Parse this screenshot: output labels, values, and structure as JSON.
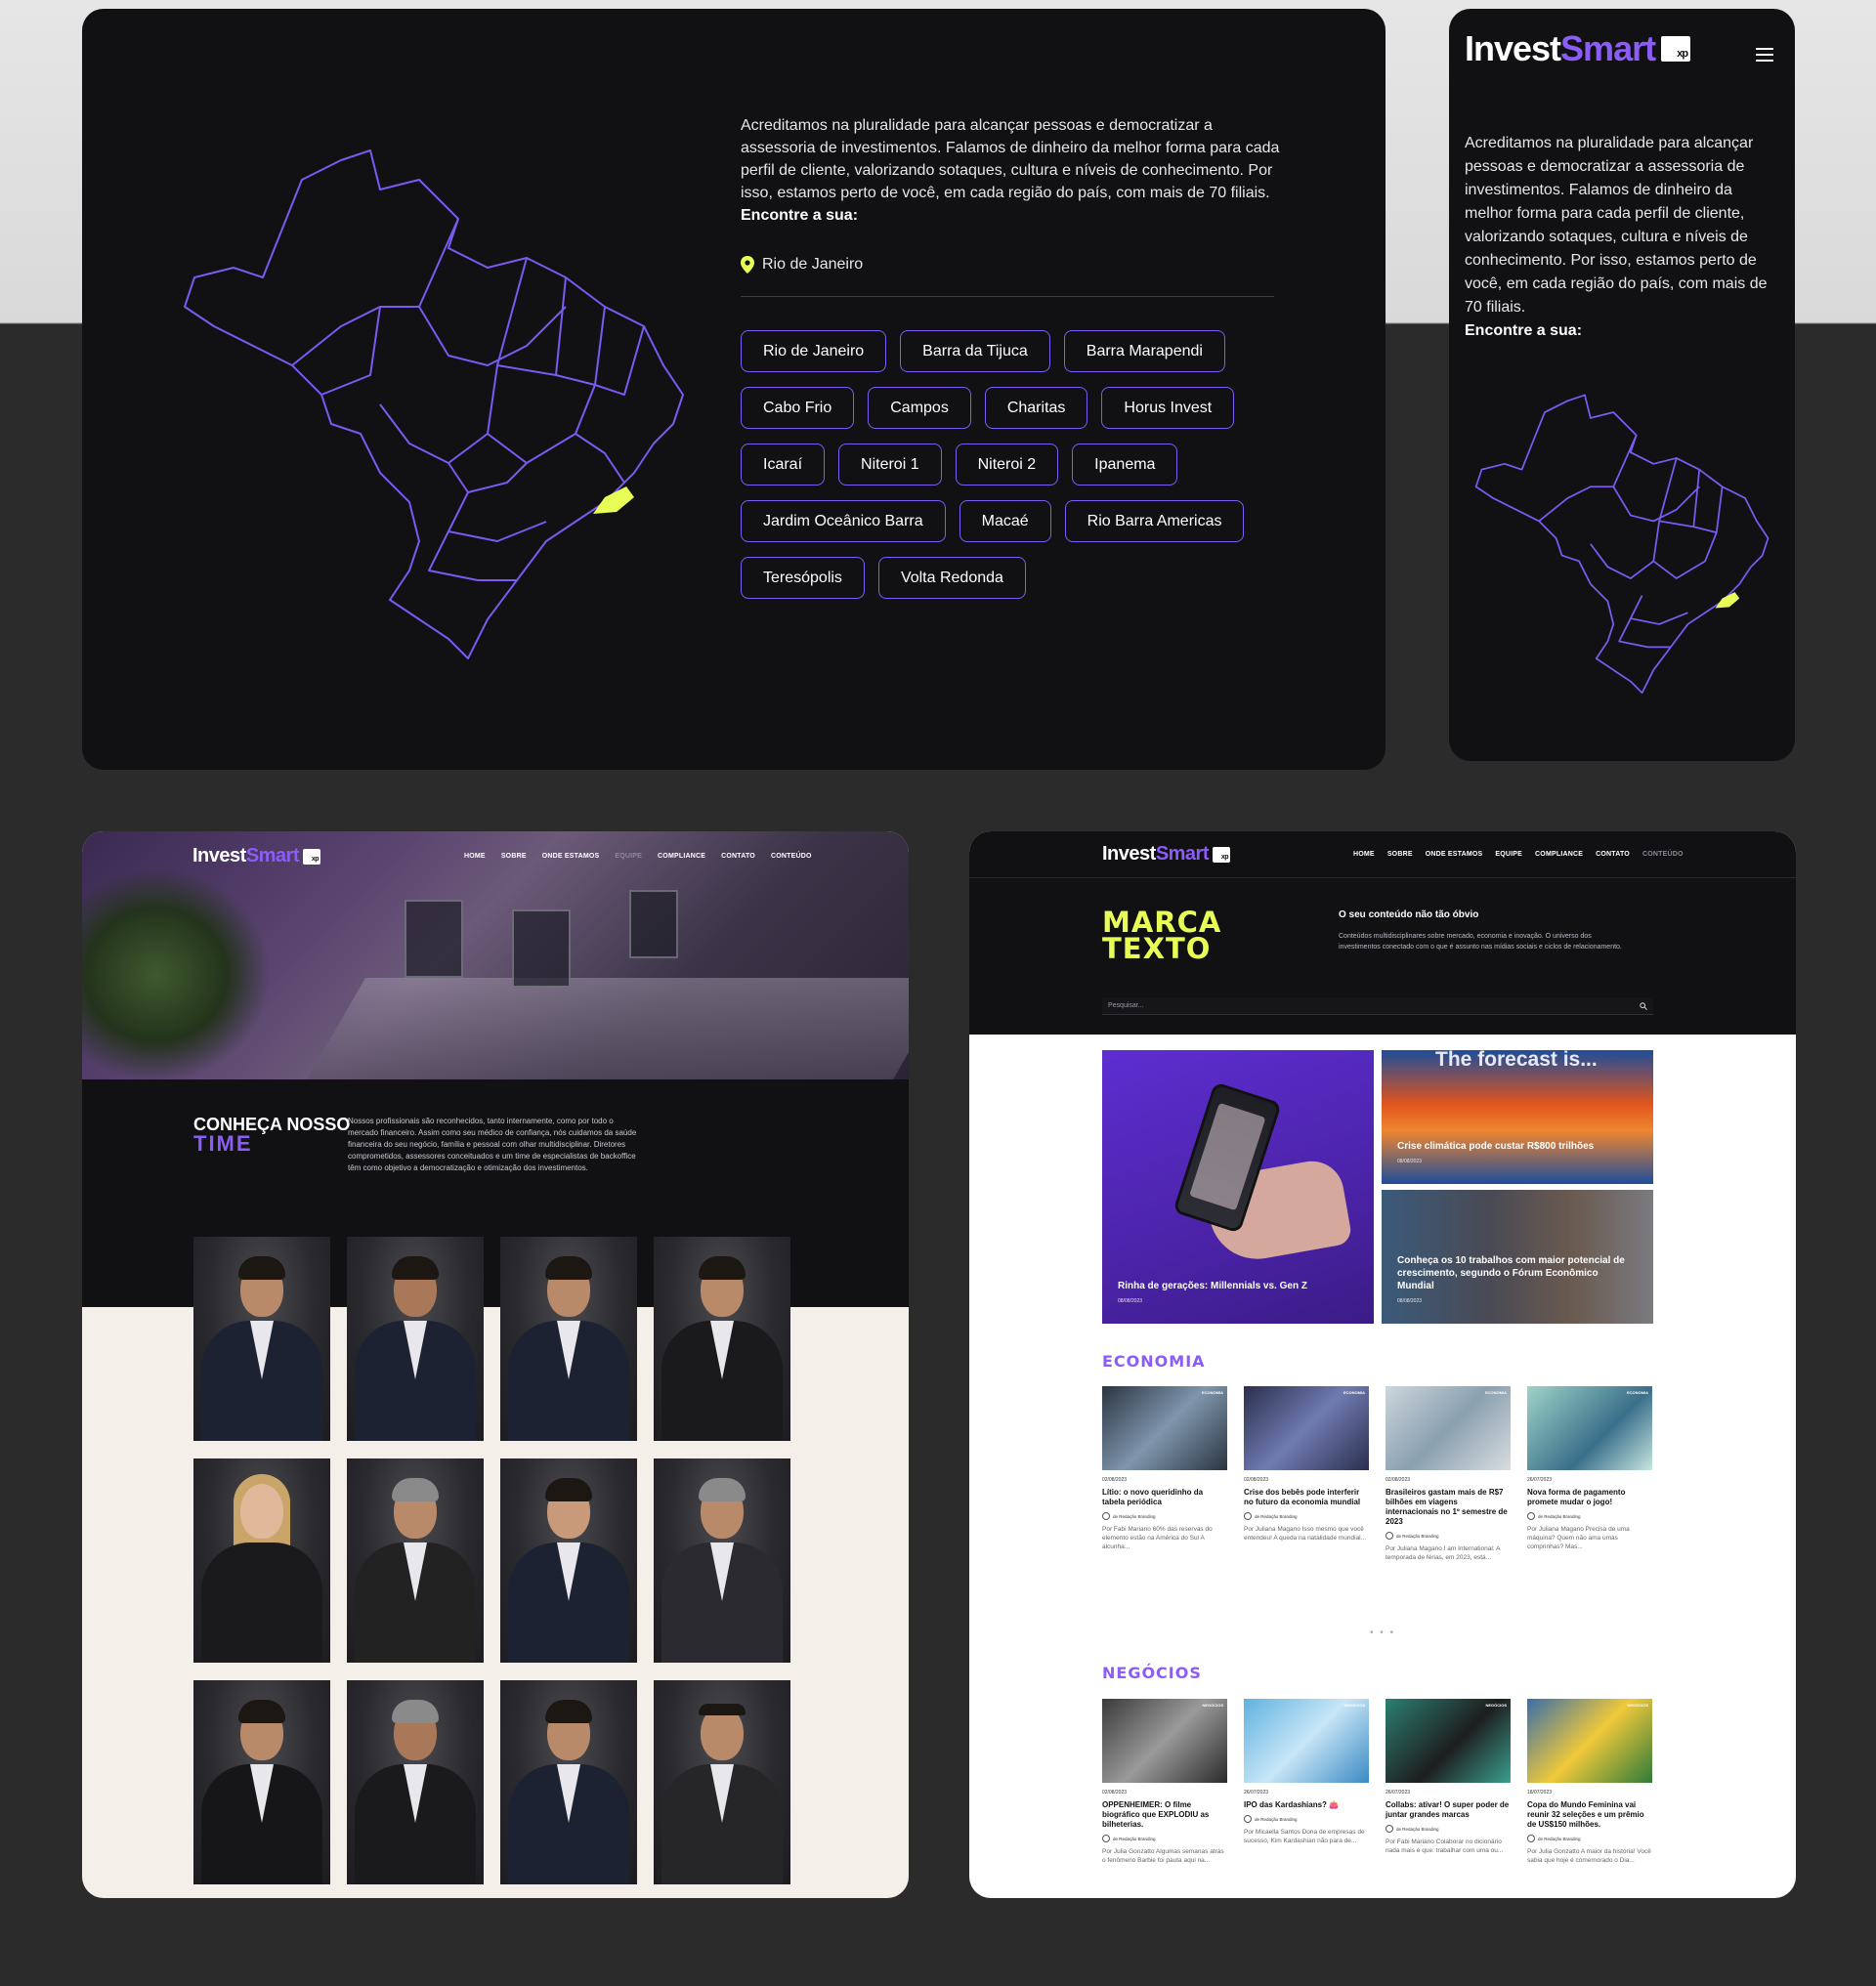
{
  "desktop": {
    "intro": "Acreditamos na pluralidade para alcançar pessoas e democratizar a assessoria de investimentos. Falamos de dinheiro da melhor forma para cada perfil de cliente, valorizando sotaques, cultura e níveis de conhecimento. Por isso, estamos perto de você, em cada região do país, com mais de 70 filiais.",
    "find_label": "Encontre a sua:",
    "selected_location": "Rio de Janeiro",
    "branches": [
      "Rio de Janeiro",
      "Barra da Tijuca",
      "Barra Marapendi",
      "Cabo Frio",
      "Campos",
      "Charitas",
      "Horus Invest",
      "Icaraí",
      "Niteroi 1",
      "Niteroi 2",
      "Ipanema",
      "Jardim Oceânico Barra",
      "Macaé",
      "Rio Barra Americas",
      "Teresópolis",
      "Volta Redonda"
    ]
  },
  "brand": {
    "invest": "Invest",
    "smart": "Smart",
    "xp": "xp",
    "accent_color": "#8b5cf6",
    "highlight_color": "#e8fd55"
  },
  "mobile": {
    "intro": "Acreditamos na pluralidade para alcançar pessoas e democratizar a assessoria de investimentos. Falamos de dinheiro da melhor forma para cada perfil de cliente, valorizando sotaques, cultura e níveis de conhecimento. Por isso, estamos perto de você, em cada região do país, com mais de 70 filiais.",
    "find_label": "Encontre a sua:",
    "menu_icon": "hamburger-icon"
  },
  "nav": [
    "HOME",
    "SOBRE",
    "ONDE ESTAMOS",
    "EQUIPE",
    "COMPLIANCE",
    "CONTATO",
    "CONTEÚDO"
  ],
  "team": {
    "title_line1": "CONHEÇA NOSSO",
    "title_line2": "TIME",
    "description": "Nossos profissionais são reconhecidos, tanto internamente, como por todo o mercado financeiro. Assim como seu médico de confiança, nós cuidamos da saúde financeira do seu negócio, família e pessoal com olhar multidisciplinar. Diretores comprometidos, assessores conceituados e um time de especialistas de backoffice têm como objetivo a democratização e otimização dos investimentos."
  },
  "news": {
    "logo_title": "MARCA\nTEXTO",
    "title_line1": "MARCA",
    "title_line2": "TEXTO",
    "subtitle": "O seu conteúdo não tão óbvio",
    "description": "Conteúdos multidisciplinares sobre mercado, economia e inovação. O universo dos investimentos conectado com o que é assunto nas mídias sociais e ciclos de relacionamento.",
    "search_placeholder": "Pesquisar...",
    "featured": [
      {
        "title": "Rinha de gerações: Millennials vs. Gen Z",
        "date": "08/08/2023"
      },
      {
        "title": "Crise climática pode custar R$800 trilhões",
        "date": "08/08/2023",
        "overlay": "The forecast is..."
      },
      {
        "title": "Conheça os 10 trabalhos com maior potencial de crescimento, segundo o Fórum Econômico Mundial",
        "date": "08/08/2023"
      }
    ],
    "section_economia": "ECONOMIA",
    "economia": [
      {
        "tag": "ECONOMIA",
        "date": "02/08/2023",
        "title": "Lítio: o novo queridinho da tabela periódica",
        "author": "de Redação Branding",
        "excerpt": "Por Fabi Mariano 60% das reservas do elemento estão na América do Sul A alcunha..."
      },
      {
        "tag": "ECONOMIA",
        "date": "02/08/2023",
        "title": "Crise dos bebês pode interferir no futuro da economia mundial",
        "author": "de Redação Branding",
        "excerpt": "Por Juliana Magano Isso mesmo que você entendeu! A queda na natalidade mundial..."
      },
      {
        "tag": "ECONOMIA",
        "date": "02/08/2023",
        "title": "Brasileiros gastam mais de R$7 bilhões em viagens internacionais no 1º semestre de 2023",
        "author": "de Redação Branding",
        "excerpt": "Por Juliana Magano I am International: A temporada de férias, em 2023, está..."
      },
      {
        "tag": "ECONOMIA",
        "date": "26/07/2023",
        "title": "Nova forma de pagamento promete mudar o jogo!",
        "author": "de Redação Branding",
        "excerpt": "Por Juliana Magano Precisa de uma máquina? Quem não ama umas comprinhas? Mas..."
      }
    ],
    "pagination": "• • •",
    "section_negocios": "NEGÓCIOS",
    "negocios": [
      {
        "tag": "NEGÓCIOS",
        "date": "02/08/2023",
        "title": "OPPENHEIMER: O filme biográfico que EXPLODIU as bilheterias.",
        "author": "de Redação Branding",
        "excerpt": "Por Julia Gonzatto Algumas semanas atrás o fenômeno Barbie foi pauta aqui na..."
      },
      {
        "tag": "NEGÓCIOS",
        "date": "26/07/2023",
        "title": "IPO das Kardashians? 👛",
        "author": "de Redação Branding",
        "excerpt": "Por Micaella Santos Dona de empresas de sucesso, Kim Kardashian não para de..."
      },
      {
        "tag": "NEGÓCIOS",
        "date": "26/07/2023",
        "title": "Collabs: ativar! O super poder de juntar grandes marcas",
        "author": "de Redação Branding",
        "excerpt": "Por Fabi Mariano Colaborar no dicionário nada mais é que: trabalhar com uma ou..."
      },
      {
        "tag": "NEGÓCIOS",
        "date": "18/07/2023",
        "title": "Copa do Mundo Feminina vai reunir 32 seleções e um prêmio de US$150 milhões.",
        "author": "de Redação Branding",
        "excerpt": "Por Julia Gonzatto A maior da história! Você sabia que hoje é comemorado o Dia..."
      }
    ]
  }
}
